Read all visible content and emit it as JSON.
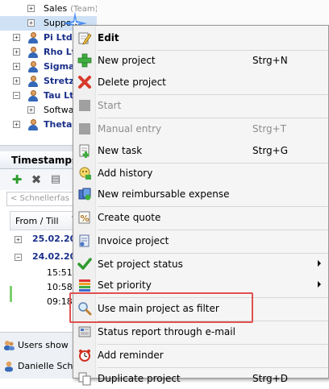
{
  "tree": {
    "rows": [
      {
        "label": "Sales",
        "tag": "(Team)"
      },
      {
        "label": "Suppo"
      },
      {
        "label": "Pi Ltd."
      },
      {
        "label": "Rho Ltd"
      },
      {
        "label": "Sigma"
      },
      {
        "label": "Stretz"
      },
      {
        "label": "Tau Lt"
      },
      {
        "label": "Softwa"
      },
      {
        "label": "Theta"
      }
    ],
    "expander_plus": "+",
    "expander_minus": "−"
  },
  "timestamps": {
    "title": "Timestamps",
    "search_placeholder": "< Schnellerfas",
    "column_header": "From / Till",
    "dates": [
      "25.02.20",
      "24.02.20"
    ],
    "times": [
      "15:51",
      "10:58",
      "09:18"
    ]
  },
  "status": {
    "users_label": "Users show",
    "user_name": "Danielle Sch"
  },
  "context_menu": {
    "items": [
      {
        "label": "Edit",
        "icon": "edit-icon"
      },
      {
        "label": "New project",
        "shortcut": "Strg+N",
        "icon": "plus-icon"
      },
      {
        "label": "Delete project",
        "icon": "delete-icon"
      },
      {
        "label": "Start",
        "icon": "start-icon"
      },
      {
        "label": "Manual entry",
        "shortcut": "Strg+T",
        "icon": "manual-entry-icon"
      },
      {
        "label": "New task",
        "shortcut": "Strg+G",
        "icon": "new-task-icon"
      },
      {
        "label": "Add history",
        "icon": "history-icon"
      },
      {
        "label": "New reimbursable expense",
        "icon": "expense-icon"
      },
      {
        "label": "Create quote",
        "icon": "quote-icon"
      },
      {
        "label": "Invoice project",
        "icon": "invoice-icon"
      },
      {
        "label": "Set project status",
        "icon": "checkmark-icon"
      },
      {
        "label": "Set priority",
        "icon": "priority-icon"
      },
      {
        "label": "Use main project as filter",
        "icon": "magnifier-icon"
      },
      {
        "label": "Status report through e-mail",
        "icon": "report-icon"
      },
      {
        "label": "Add reminder",
        "icon": "alarm-clock-icon"
      },
      {
        "label": "Duplicate project",
        "shortcut": "Strg+D",
        "icon": "duplicate-icon"
      }
    ]
  },
  "colors": {
    "highlight_box": "#e05050",
    "selection": "#cfe1f5",
    "link_blue": "#1a2f8a"
  }
}
